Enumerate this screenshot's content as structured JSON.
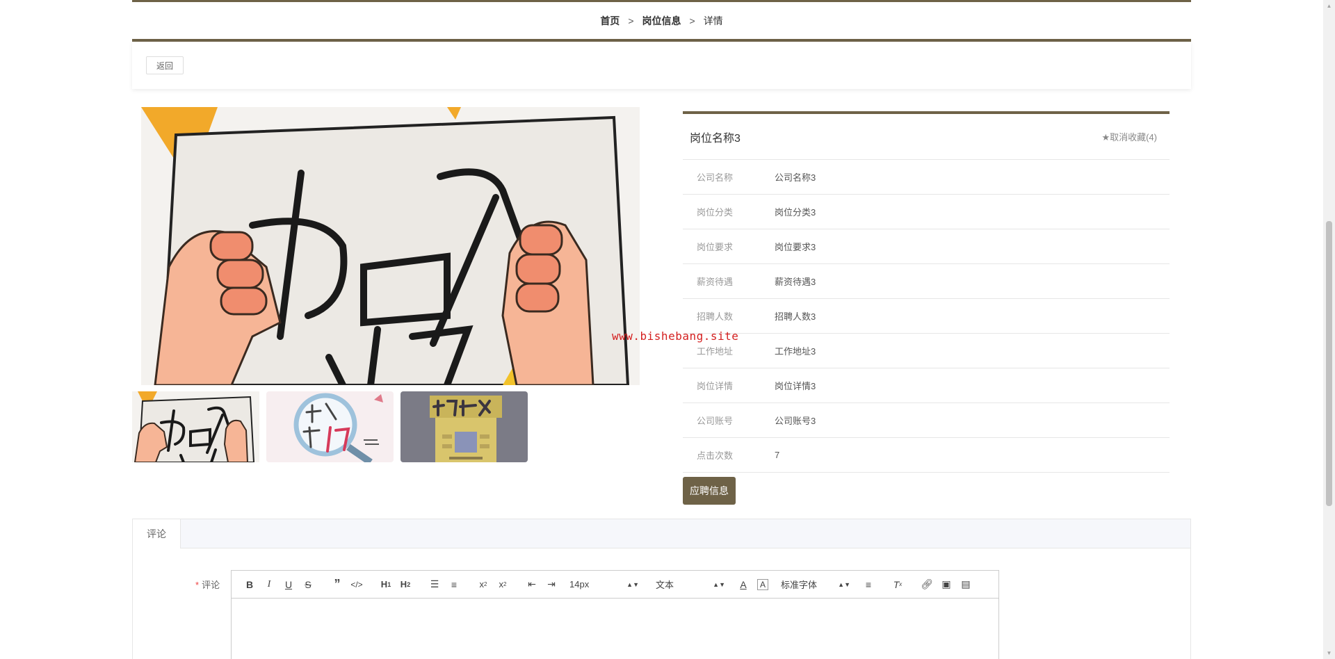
{
  "breadcrumb": {
    "home": "首页",
    "parent": "岗位信息",
    "current": "详情",
    "separator": ">"
  },
  "back_button": "返回",
  "gallery": {
    "main_alt": "加入我们",
    "thumbs": [
      "加入我们",
      "找的就是你",
      "招募令"
    ]
  },
  "job": {
    "title": "岗位名称3",
    "favorite": "★取消收藏(4)",
    "rows": [
      {
        "label": "公司名称",
        "value": "公司名称3"
      },
      {
        "label": "岗位分类",
        "value": "岗位分类3"
      },
      {
        "label": "岗位要求",
        "value": "岗位要求3"
      },
      {
        "label": "薪资待遇",
        "value": "薪资待遇3"
      },
      {
        "label": "招聘人数",
        "value": "招聘人数3"
      },
      {
        "label": "工作地址",
        "value": "工作地址3"
      },
      {
        "label": "岗位详情",
        "value": "岗位详情3"
      },
      {
        "label": "公司账号",
        "value": "公司账号3"
      },
      {
        "label": "点击次数",
        "value": "7"
      }
    ],
    "apply_button": "应聘信息"
  },
  "watermark": "www.bishebang.site",
  "comment": {
    "tab": "评论",
    "required_mark": "*",
    "label": "评论",
    "font_size": "14px",
    "block_type": "文本",
    "font_family": "标准字体"
  },
  "colors": {
    "accent": "#6e6247",
    "watermark": "#d42020"
  }
}
